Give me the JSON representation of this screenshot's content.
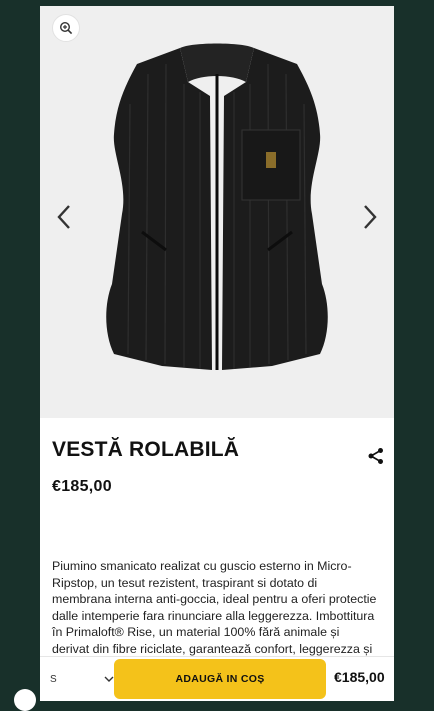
{
  "product": {
    "title": "VESTĂ ROLABILĂ",
    "price": "€185,00",
    "description": "Piumino smanicato realizat cu guscio esterno in Micro-Ripstop, un tesut rezistent, traspirant si dotato di membrana interna anti-goccia, ideal pentru a oferi protectie dalle intemperie fara rinunciare alla leggerezza. Imbottitura în Primaloft® Rise, un material 100% fără animale și derivat din fibre riciclate, garantează confort, leggerezza și traspirabilitate per la più intensa attività."
  },
  "gallery": {
    "zoom_icon": "zoom-in-icon",
    "prev_icon": "chevron-left-icon",
    "next_icon": "chevron-right-icon",
    "image_alt": "black quilted vest"
  },
  "purchase_bar": {
    "size_value": "S",
    "add_label": "ADAUGĂ IN COȘ",
    "price": "€185,00"
  },
  "colors": {
    "background": "#18302a",
    "gallery_bg": "#efefef",
    "accent": "#f4c21a"
  }
}
